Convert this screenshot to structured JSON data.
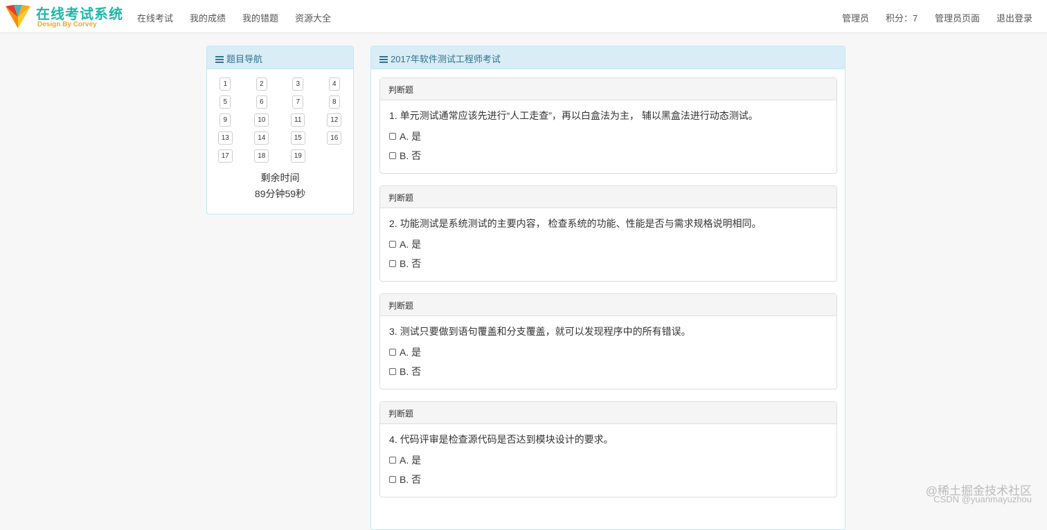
{
  "nav": {
    "brand": "在线考试系统",
    "brand_sub": "Design By Corvey",
    "links": [
      "在线考试",
      "我的成绩",
      "我的错题",
      "资源大全"
    ],
    "user": "管理员",
    "points": "积分：7",
    "admin_page": "管理员页面",
    "logout": "退出登录"
  },
  "sidebar": {
    "title": "题目导航",
    "numbers": [
      "1",
      "2",
      "3",
      "4",
      "5",
      "6",
      "7",
      "8",
      "9",
      "10",
      "11",
      "12",
      "13",
      "14",
      "15",
      "16",
      "17",
      "18",
      "19"
    ],
    "timer_label": "剩余时间",
    "timer_value": "89分钟59秒"
  },
  "exam": {
    "title": "2017年软件测试工程师考试",
    "questions": [
      {
        "type": "判断题",
        "text": "1. 单元测试通常应该先进行“人工走查”，再以白盒法为主， 辅以黑盒法进行动态测试。",
        "options": [
          "A. 是",
          "B. 否"
        ]
      },
      {
        "type": "判断题",
        "text": "2. 功能测试是系统测试的主要内容， 检查系统的功能、性能是否与需求规格说明相同。",
        "options": [
          "A. 是",
          "B. 否"
        ]
      },
      {
        "type": "判断题",
        "text": "3. 测试只要做到语句覆盖和分支覆盖，就可以发现程序中的所有错误。",
        "options": [
          "A. 是",
          "B. 否"
        ]
      },
      {
        "type": "判断题",
        "text": "4. 代码评审是检查源代码是否达到模块设计的要求。",
        "options": [
          "A. 是",
          "B. 否"
        ]
      }
    ]
  },
  "watermark": {
    "line1": "@稀土掘金技术社区",
    "line2": "CSDN @yuanmayuzhou"
  }
}
